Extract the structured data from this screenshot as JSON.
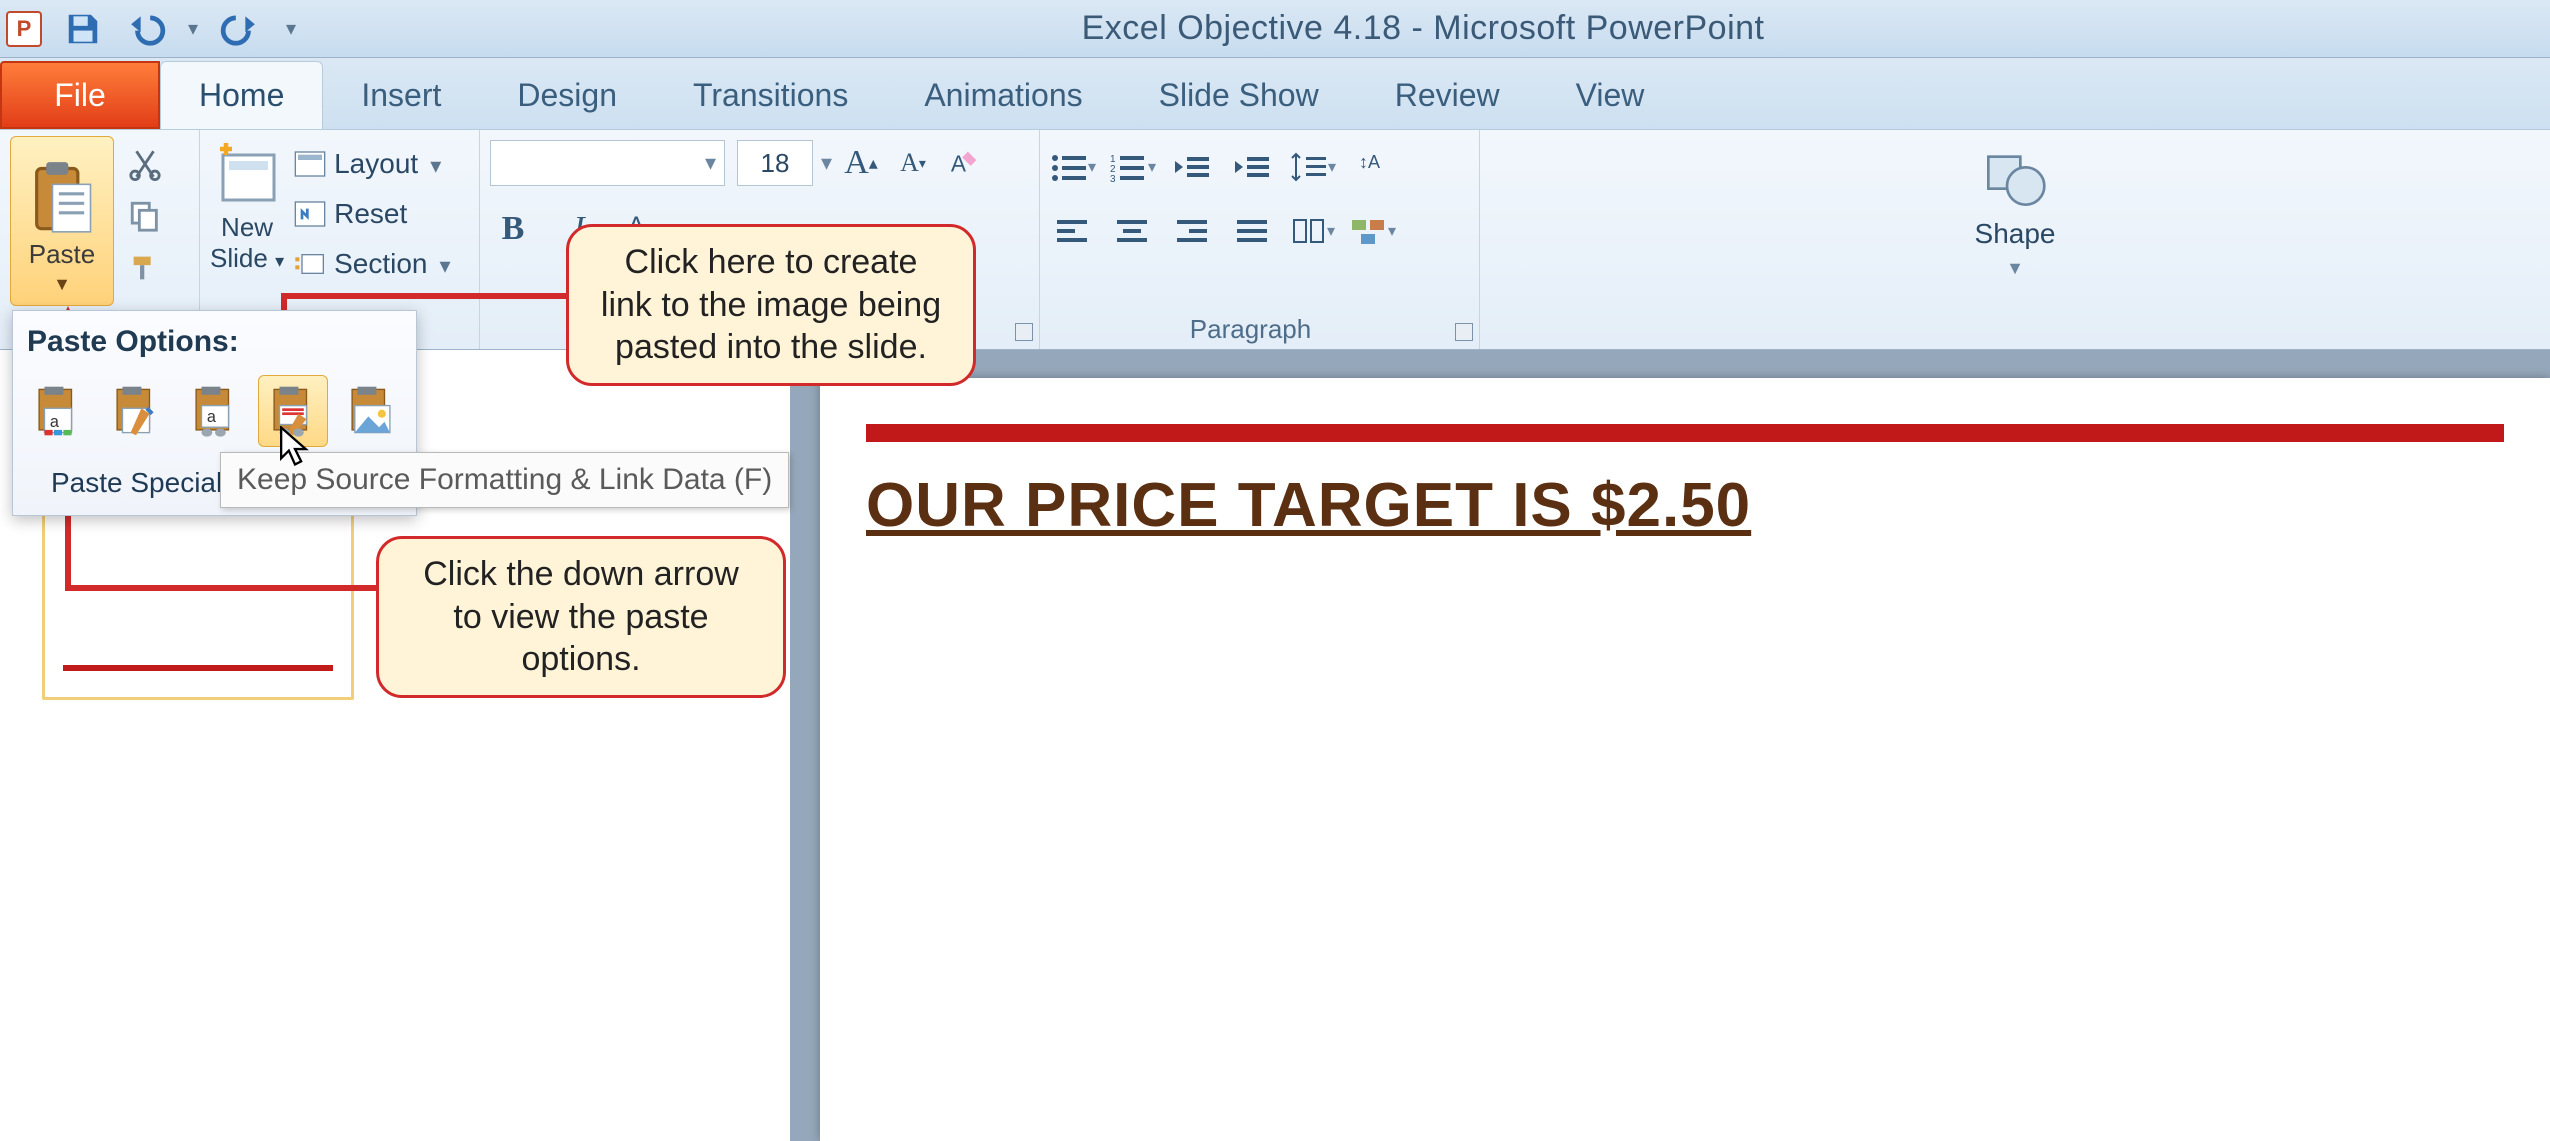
{
  "title": "Excel Objective 4.18  -  Microsoft PowerPoint",
  "qat": {
    "save": "save-icon",
    "undo": "undo-icon",
    "redo": "redo-icon"
  },
  "tabs": {
    "file": "File",
    "items": [
      "Home",
      "Insert",
      "Design",
      "Transitions",
      "Animations",
      "Slide Show",
      "Review",
      "View"
    ],
    "active": 0
  },
  "ribbon": {
    "clipboard": {
      "paste": "Paste"
    },
    "slides": {
      "new": "New",
      "slide": "Slide",
      "layout": "Layout",
      "reset": "Reset",
      "section": "Section"
    },
    "font": {
      "size": "18"
    },
    "paragraph": {
      "label": "Paragraph"
    },
    "drawing": {
      "shapes": "Shape"
    }
  },
  "paste_popup": {
    "title": "Paste Options:",
    "special": "Paste Special",
    "tooltip": "Keep Source Formatting & Link Data (F)",
    "options": [
      "use-destination-theme",
      "keep-source-formatting",
      "embed",
      "keep-source-formatting-link",
      "picture"
    ]
  },
  "callouts": {
    "c1": "Click here to create link to the image being pasted into the slide.",
    "c2": "Click the down arrow to view the paste options."
  },
  "slide": {
    "headline": "OUR PRICE TARGET IS $2.50"
  }
}
